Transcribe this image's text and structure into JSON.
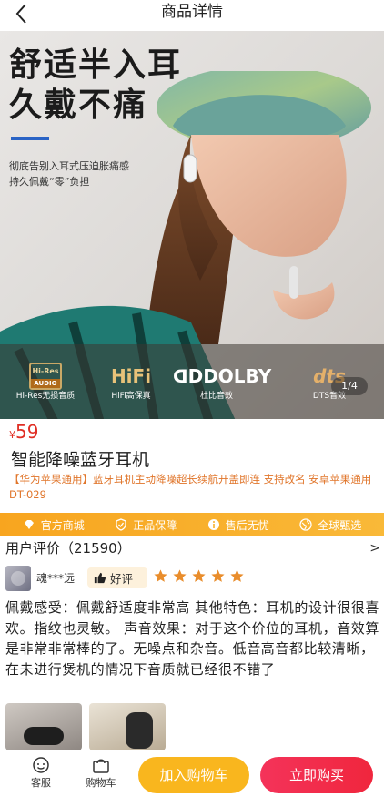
{
  "header": {
    "title": "商品详情"
  },
  "banner": {
    "headline": [
      "舒适半入耳",
      "久戴不痛"
    ],
    "subtext": [
      "彻底告别入耳式压迫胀痛感",
      "持久佩戴“零”负担"
    ],
    "features": [
      {
        "logo": "Hi-Res",
        "logo_sub": "AUDIO",
        "caption": "Hi-Res无损音质"
      },
      {
        "logo": "HiFi",
        "caption": "HiFi高保真"
      },
      {
        "logo": "DOLBY",
        "caption": "杜比音效"
      },
      {
        "logo": "dts",
        "caption": "DTS音效"
      }
    ],
    "pager": "1/4"
  },
  "product": {
    "currency": "¥",
    "price": "59",
    "name": "智能降噪蓝牙耳机",
    "description": "【华为苹果通用】蓝牙耳机主动降噪超长续航开盖即连 支持改名 安卓苹果通用DT-029"
  },
  "guarantees": [
    {
      "icon": "diamond-icon",
      "label": "官方商城"
    },
    {
      "icon": "shield-check-icon",
      "label": "正品保障"
    },
    {
      "icon": "info-circle-icon",
      "label": "售后无忧"
    },
    {
      "icon": "globe-icon",
      "label": "全球甄选"
    }
  ],
  "reviews": {
    "header": "用户评价（21590）",
    "more": ">",
    "first": {
      "user": "魂***远",
      "badge": "好评",
      "stars": 5,
      "text": "佩戴感受：佩戴舒适度非常高 其他特色：耳机的设计很很喜欢。指纹也灵敏。 声音效果：对于这个价位的耳机，音效算是非常非常棒的了。无噪点和杂音。低音高音都比较清晰，在未进行煲机的情况下音质就已经很不错了"
    }
  },
  "bottom_bar": {
    "service": "客服",
    "cart": "购物车",
    "add_to_cart": "加入购物车",
    "buy_now": "立即购买"
  },
  "colors": {
    "price": "#e02e24",
    "accent_orange": "#f9b61e",
    "buy_red": "#f0263d",
    "desc_orange": "#e0752a"
  }
}
